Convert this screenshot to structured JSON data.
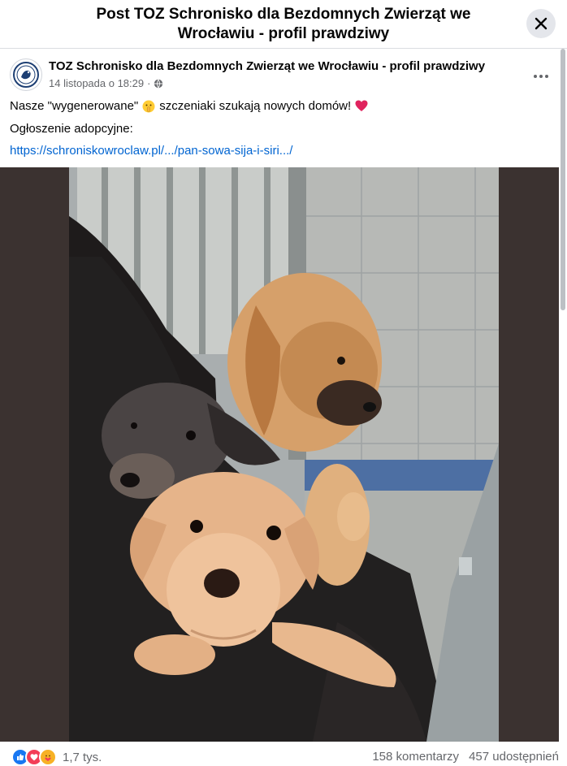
{
  "dialog": {
    "title": "Post TOZ Schronisko dla Bezdomnych Zwierząt we Wrocławiu - profil prawdziwy"
  },
  "post": {
    "author": "TOZ Schronisko dla Bezdomnych Zwierząt we Wrocławiu - profil prawdziwy",
    "timestamp": "14 listopada o 18:29",
    "text_before_emoji": "Nasze \"wygenerowane\"",
    "text_after_emoji": "szczeniaki szukają nowych domów!",
    "adoption_label": "Ogłoszenie adopcyjne:",
    "link": "https://schroniskowroclaw.pl/.../pan-sowa-sija-i-siri.../"
  },
  "footer": {
    "reactions_count": "1,7 tys.",
    "comments": "158 komentarzy",
    "shares": "457 udostępnień"
  },
  "icons": {
    "close": "close-icon",
    "more": "more-options-icon",
    "privacy": "globe-icon",
    "reactions": [
      "like-icon",
      "love-icon",
      "care-icon"
    ]
  },
  "colors": {
    "link": "#0064d1",
    "like": "#1877f2",
    "love": "#f33e58",
    "care": "#f7b125"
  }
}
